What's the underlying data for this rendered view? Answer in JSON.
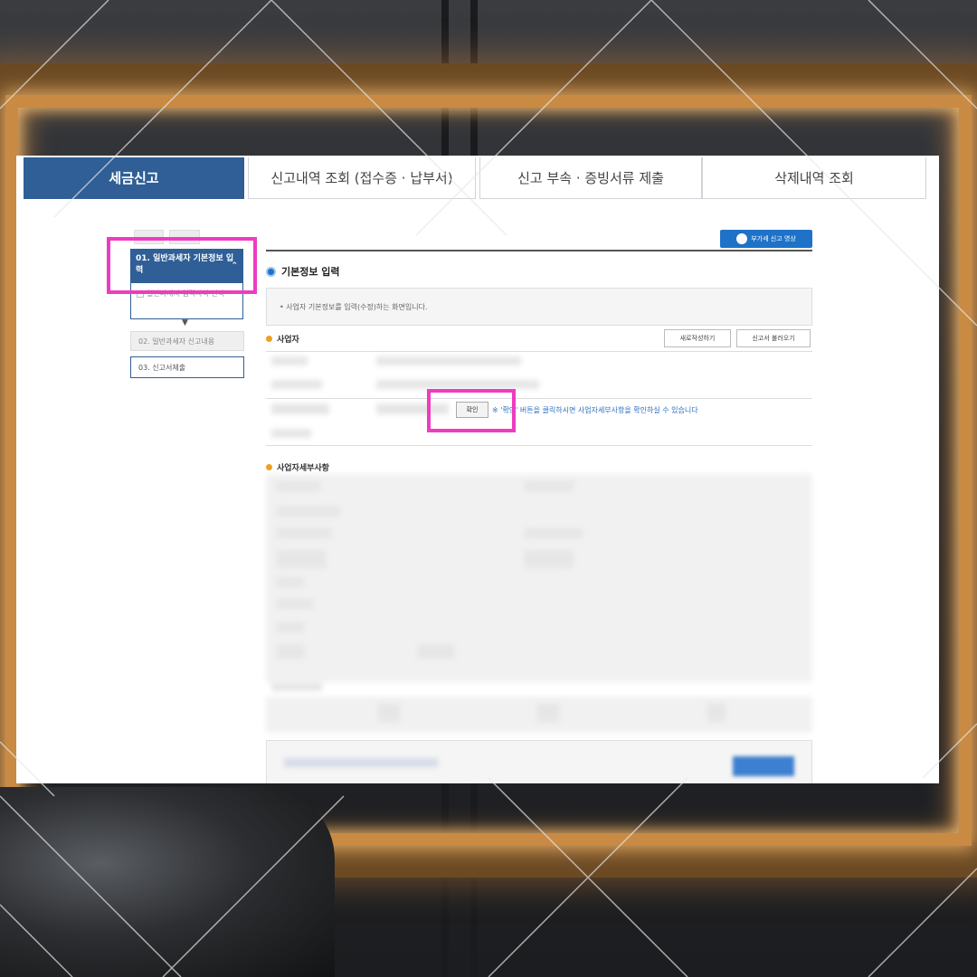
{
  "tabs": [
    {
      "label": "세금신고"
    },
    {
      "label": "신고내역 조회 (접수증 · 납부서)"
    },
    {
      "label": "신고 부속 · 증빙서류 제출"
    },
    {
      "label": "삭제내역 조회"
    }
  ],
  "side_menu": {
    "steps": [
      {
        "label": "01. 일반과세자 기본정보 입력"
      },
      {
        "label": "일반과세자 입력서식 선택"
      },
      {
        "label": "02. 일반과세자 신고내용"
      },
      {
        "label": "03. 신고서제출"
      }
    ]
  },
  "main": {
    "guide_button": "부가세 신고 영상",
    "section_title": "기본정보 입력",
    "info_text": "• 사업자 기본정보를 입력(수정)하는 화면입니다.",
    "business_label": "사업자",
    "new_button": "새로작성하기",
    "load_button": "신고서 불러오기",
    "confirm_button": "확인",
    "confirm_note": "※ '확인' 버튼을 클릭하시면 사업자세부사항을 확인하실 수 있습니다",
    "details_label": "사업자세부사항"
  },
  "colors": {
    "accent": "#2f5f96",
    "highlight": "#ee3cc0",
    "link": "#2a6fc0"
  }
}
